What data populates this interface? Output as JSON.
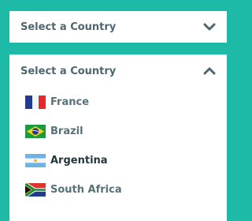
{
  "closed_select": {
    "label": "Select a Country",
    "icon": "chevron-down-icon"
  },
  "open_select": {
    "label": "Select a Country",
    "icon": "chevron-up-icon",
    "options": [
      {
        "label": "France",
        "flag": "france-flag-icon"
      },
      {
        "label": "Brazil",
        "flag": "brazil-flag-icon"
      },
      {
        "label": "Argentina",
        "flag": "argentina-flag-icon"
      },
      {
        "label": "South Africa",
        "flag": "south-africa-flag-icon"
      }
    ],
    "highlighted_option": "Argentina"
  },
  "colors": {
    "background": "#1dbaa8",
    "panel": "#ffffff",
    "label_text": "#4d6670",
    "option_text": "#55727a",
    "highlighted_text": "#24373f"
  }
}
